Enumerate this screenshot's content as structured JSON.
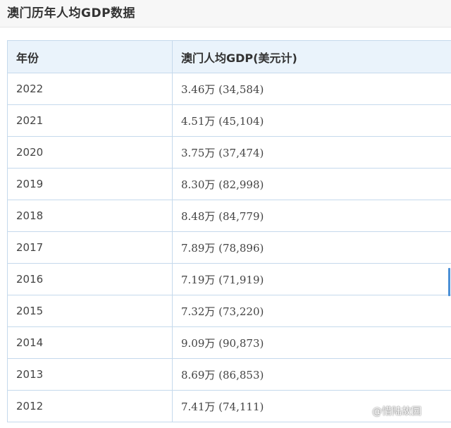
{
  "page": {
    "title": "澳门历年人均GDP数据"
  },
  "table": {
    "headers": [
      "年份",
      "澳门人均GDP(美元计)"
    ],
    "rows": [
      {
        "year": "2022",
        "gdp": "3.46万 (34,584)"
      },
      {
        "year": "2021",
        "gdp": "4.51万 (45,104)"
      },
      {
        "year": "2020",
        "gdp": "3.75万 (37,474)"
      },
      {
        "year": "2019",
        "gdp": "8.30万 (82,998)"
      },
      {
        "year": "2018",
        "gdp": "8.48万 (84,779)"
      },
      {
        "year": "2017",
        "gdp": "7.89万 (78,896)"
      },
      {
        "year": "2016",
        "gdp": "7.19万 (71,919)"
      },
      {
        "year": "2015",
        "gdp": "7.32万 (73,220)"
      },
      {
        "year": "2014",
        "gdp": "9.09万 (90,873)"
      },
      {
        "year": "2013",
        "gdp": "8.69万 (86,853)"
      },
      {
        "year": "2012",
        "gdp": "7.41万 (74,111)"
      }
    ]
  },
  "watermark": {
    "text": "@惜陆故园"
  },
  "colors": {
    "header_bg": "#eaf3fb",
    "border": "#c5d9ec",
    "title_bar_bg": "#f7f7f7",
    "scroll_accent": "#4a8fd6"
  }
}
